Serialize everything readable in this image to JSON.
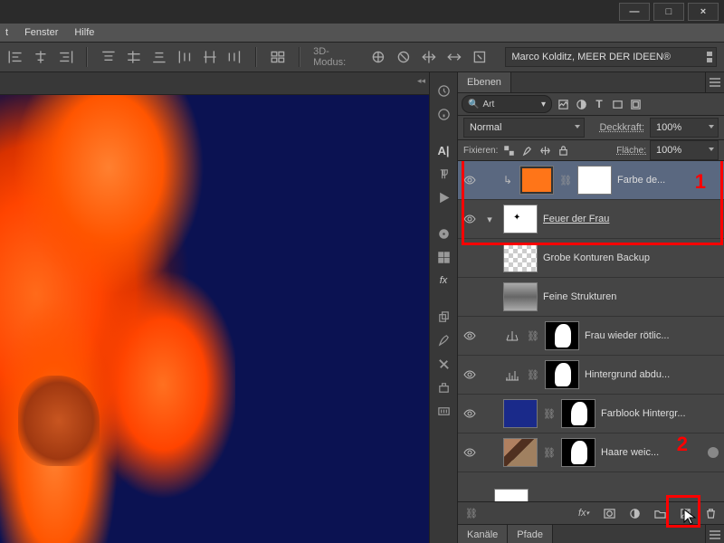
{
  "menu": {
    "window": "Fenster",
    "help": "Hilfe",
    "partial": "t"
  },
  "winctl": {
    "min": "—",
    "max": "□",
    "close": "×"
  },
  "toolbar": {
    "mode3d_label": "3D-Modus:",
    "workspace": "Marco Kolditz, MEER DER IDEEN®"
  },
  "panel": {
    "layers_tab": "Ebenen",
    "search_label": "Art",
    "blend_mode": "Normal",
    "opacity_label": "Deckkraft:",
    "opacity_value": "100%",
    "lock_label": "Fixieren:",
    "fill_label": "Fläche:",
    "fill_value": "100%"
  },
  "layers": [
    {
      "name": "Farbe de...",
      "visible": true,
      "selected": true,
      "clipped": true,
      "kind": "fill-orange",
      "mask": true
    },
    {
      "name": "Feuer der Frau",
      "visible": true,
      "underline": true,
      "kind": "group-fire"
    },
    {
      "name": "Grobe Konturen Backup",
      "visible": false,
      "kind": "checker"
    },
    {
      "name": "Feine Strukturen",
      "visible": false,
      "kind": "checker-fire"
    },
    {
      "name": "Frau wieder rötlic...",
      "visible": true,
      "kind": "adj-balance",
      "mask": true
    },
    {
      "name": "Hintergrund abdu...",
      "visible": true,
      "kind": "adj-levels",
      "mask": true
    },
    {
      "name": "Farblook Hintergr...",
      "visible": true,
      "kind": "fill-navy",
      "mask": true
    },
    {
      "name": "Haare weic...",
      "visible": true,
      "kind": "photo",
      "mask": true,
      "smart": true
    }
  ],
  "callouts": {
    "c1": "1",
    "c2": "2"
  },
  "bottom_tabs": {
    "channels": "Kanäle",
    "paths": "Pfade"
  }
}
